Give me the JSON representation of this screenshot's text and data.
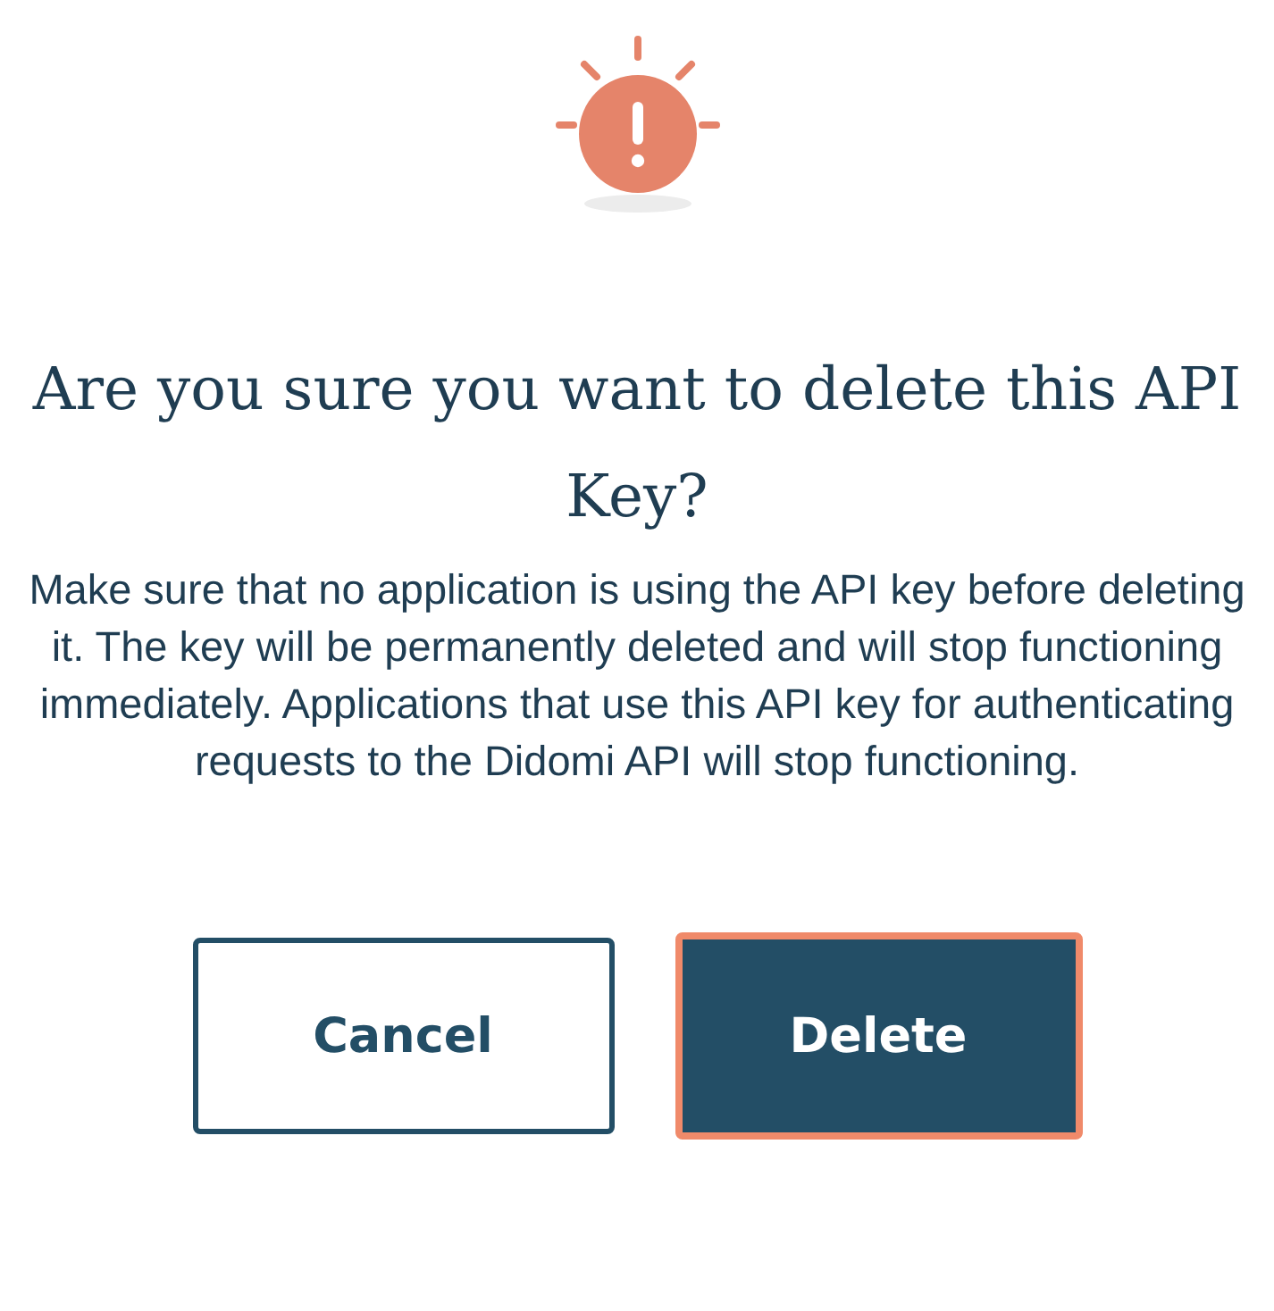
{
  "dialog": {
    "title": "Are you sure you want to delete this API Key?",
    "message": "Make sure that no application is using the API key before deleting it. The key will be permanently deleted and will stop functioning immediately. Applications that use this API key for authenticating requests to the Didomi API will stop functioning.",
    "buttons": [
      {
        "label": "Cancel",
        "kind": "secondary",
        "focused": false
      },
      {
        "label": "Delete",
        "kind": "primary",
        "focused": true
      }
    ]
  }
}
